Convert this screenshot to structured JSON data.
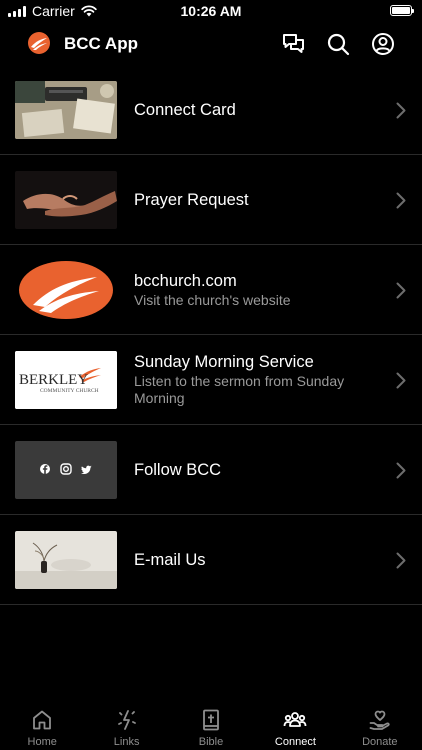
{
  "status_bar": {
    "carrier": "Carrier",
    "time": "10:26 AM"
  },
  "header": {
    "title": "BCC App",
    "icons": [
      "chat-icon",
      "search-icon",
      "profile-icon"
    ]
  },
  "items": [
    {
      "title": "Connect Card",
      "subtitle": "",
      "thumb": "desk-photo"
    },
    {
      "title": "Prayer Request",
      "subtitle": "",
      "thumb": "hands-photo"
    },
    {
      "title": "bcchurch.com",
      "subtitle": "Visit the church's website",
      "thumb": "bcc-logo"
    },
    {
      "title": "Sunday Morning Service",
      "subtitle": "Listen to the sermon from Sunday Morning",
      "thumb": "berkley-logo"
    },
    {
      "title": "Follow BCC",
      "subtitle": "",
      "thumb": "social-icons"
    },
    {
      "title": "E-mail Us",
      "subtitle": "",
      "thumb": "vase-photo"
    }
  ],
  "thumb_text": {
    "berkley_main": "BERKLEY",
    "berkley_sub": "COMMUNITY CHURCH"
  },
  "tabs": [
    {
      "label": "Home",
      "icon": "home-icon"
    },
    {
      "label": "Links",
      "icon": "sparkle-icon"
    },
    {
      "label": "Bible",
      "icon": "bible-icon"
    },
    {
      "label": "Connect",
      "icon": "people-icon",
      "active": true
    },
    {
      "label": "Donate",
      "icon": "donate-icon"
    }
  ],
  "colors": {
    "background": "#000000",
    "accent": "#e9622f",
    "text": "#ffffff",
    "muted": "#9a9a9a"
  }
}
